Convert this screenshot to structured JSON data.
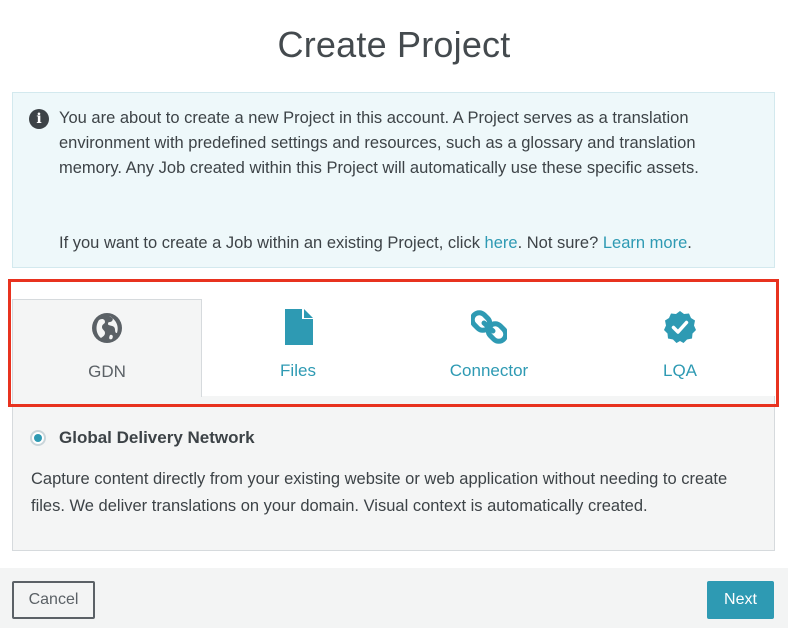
{
  "dialog": {
    "title": "Create Project"
  },
  "info": {
    "text_line": "You are about to create a new Project in this account. A Project serves as a translation environment with predefined settings and resources, such as a glossary and translation memory. Any Job created within this Project will automatically use these specific assets.",
    "prefix": "If you want to create a Job within an existing Project, click ",
    "here_link": "here",
    "middle": ". Not sure? ",
    "learn_link": "Learn more",
    "suffix": "."
  },
  "tabs": [
    {
      "label": "GDN",
      "icon": "globe-icon",
      "active": true
    },
    {
      "label": "Files",
      "icon": "file-icon",
      "active": false
    },
    {
      "label": "Connector",
      "icon": "link-icon",
      "active": false
    },
    {
      "label": "LQA",
      "icon": "check-badge-icon",
      "active": false
    }
  ],
  "option": {
    "label": "Global Delivery Network",
    "description": "Capture content directly from your existing website or web application without needing to create files. We deliver translations on your domain. Visual context is automatically created."
  },
  "footer": {
    "cancel_label": "Cancel",
    "next_label": "Next"
  },
  "colors": {
    "accent": "#2e9ab3",
    "highlight": "#e8321f",
    "info_bg": "#eef8fa"
  }
}
